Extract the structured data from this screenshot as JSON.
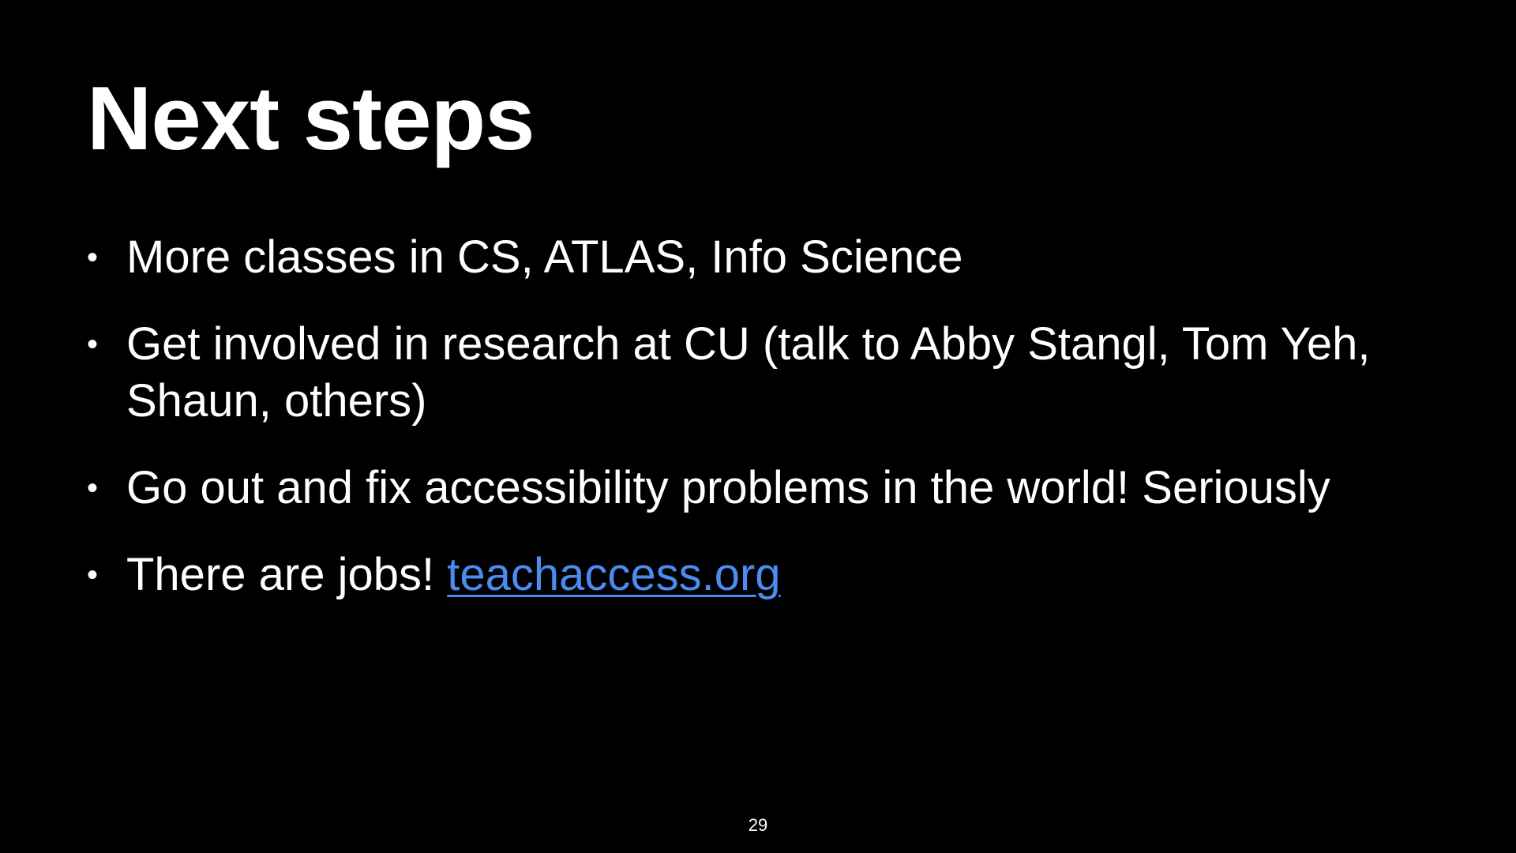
{
  "slide": {
    "title": "Next steps",
    "bullets": [
      {
        "text": "More classes in CS, ATLAS, Info Science"
      },
      {
        "text": "Get involved in research at CU (talk to Abby Stangl, Tom Yeh, Shaun, others)"
      },
      {
        "text": "Go out and fix accessibility problems in the world! Seriously"
      },
      {
        "text": "There are jobs! ",
        "link_text": "teachaccess.org"
      }
    ],
    "bullet_symbol": "•",
    "page_number": "29"
  },
  "colors": {
    "background": "#000000",
    "text": "#ffffff",
    "link": "#4a8cf0"
  }
}
